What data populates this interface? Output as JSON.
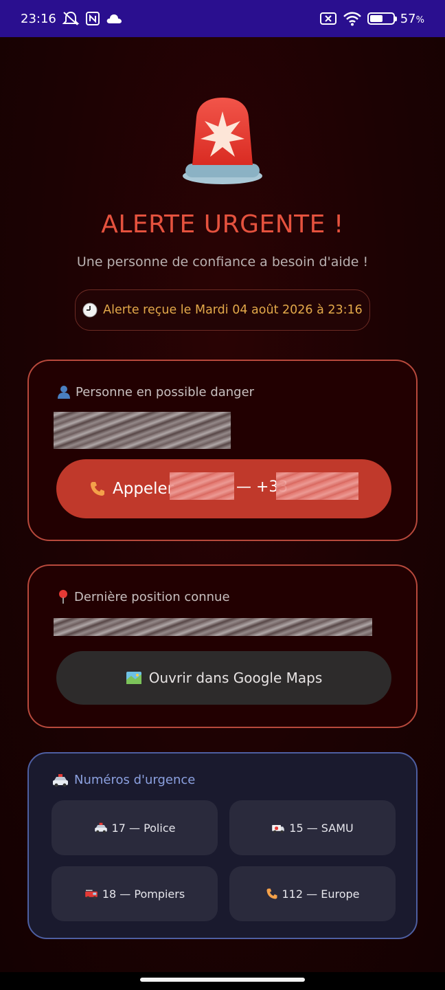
{
  "status_bar": {
    "time": "23:16",
    "battery_percent": "57",
    "battery_level": 0.57,
    "icons": [
      "bell-off-icon",
      "nfc-icon",
      "cloud-icon",
      "sim-off-icon",
      "wifi-icon",
      "battery-icon"
    ]
  },
  "header": {
    "icon": "siren-icon",
    "title": "ALERTE URGENTE !",
    "subtitle": "Une personne de confiance a besoin d'aide !",
    "alert_time": "Alerte reçue le Mardi 04 août 2026 à 23:16"
  },
  "person_card": {
    "label": "Personne en possible danger",
    "label_icon": "person-icon",
    "call_label": "Appeler",
    "call_separator": "— +33"
  },
  "location_card": {
    "label": "Dernière position connue",
    "label_icon": "pin-icon",
    "maps_label": "Ouvrir dans Google Maps",
    "maps_icon": "map-icon"
  },
  "emergency": {
    "label": "Numéros d'urgence",
    "label_icon": "police-car-icon",
    "buttons": [
      {
        "label": "17 — Police",
        "icon": "police-car-icon"
      },
      {
        "label": "15 — SAMU",
        "icon": "ambulance-icon"
      },
      {
        "label": "18 — Pompiers",
        "icon": "fire-truck-icon"
      },
      {
        "label": "112 — Europe",
        "icon": "phone-icon"
      }
    ]
  },
  "colors": {
    "accent_red": "#e5523e",
    "button_red": "#c0392b",
    "alert_text": "#e3a94a",
    "status_bar": "#2a0f8f",
    "emergency_label": "#8ca1e0"
  }
}
